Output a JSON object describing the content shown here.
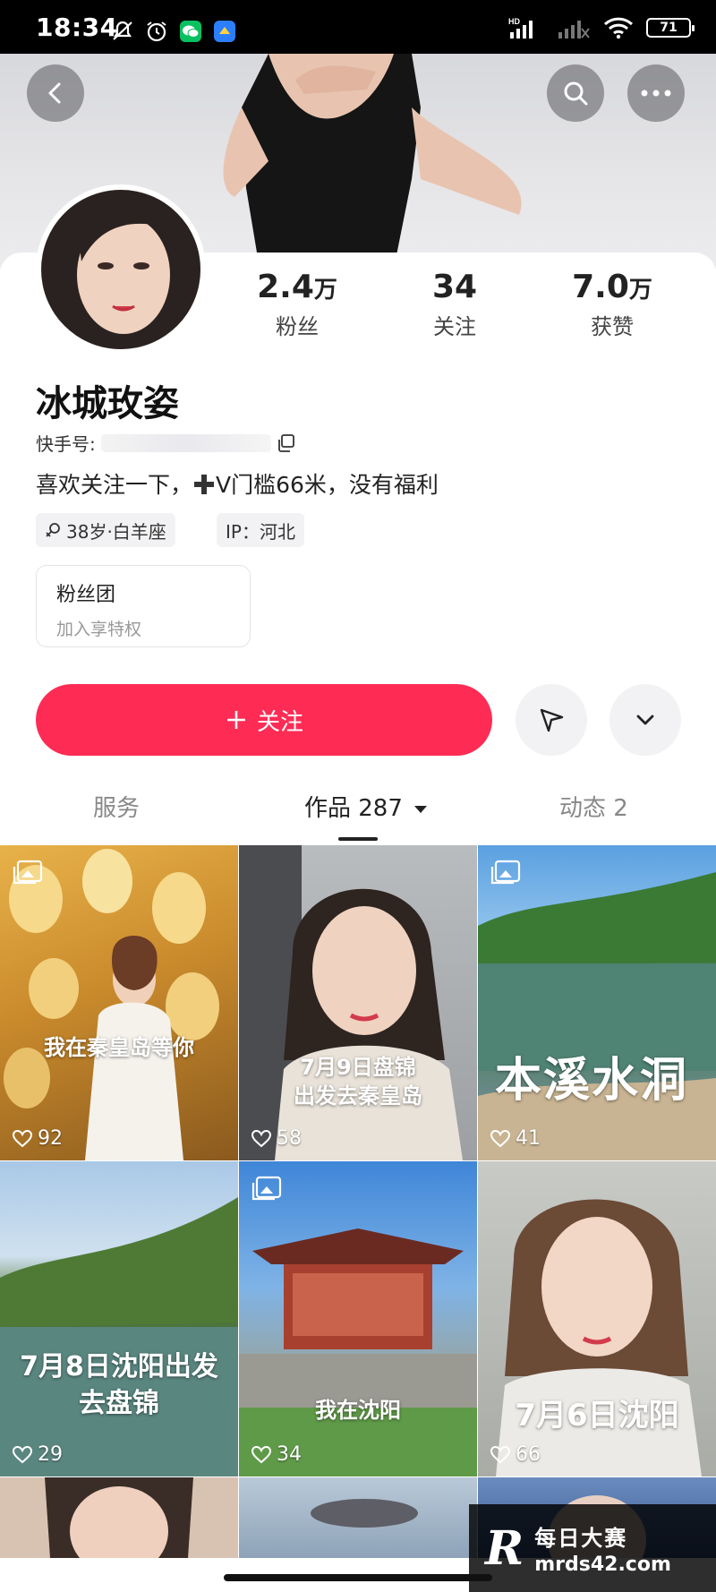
{
  "status_bar": {
    "time": "18:34",
    "network_label": "HD",
    "battery": "71"
  },
  "header": {
    "back_icon": "chevron-left-icon",
    "search_icon": "search-icon",
    "more_icon": "more-horizontal-icon"
  },
  "profile": {
    "name": "冰城玫姿",
    "kuaishou_id_label": "快手号:",
    "bio_prefix": "喜欢关注一下，",
    "bio_suffix": "V门槛66米，没有福利",
    "tags": [
      "38岁·白羊座",
      "IP：河北"
    ],
    "stats": [
      {
        "value": "2.4",
        "unit": "万",
        "label": "粉丝"
      },
      {
        "value": "34",
        "unit": "",
        "label": "关注"
      },
      {
        "value": "7.0",
        "unit": "万",
        "label": "获赞"
      }
    ],
    "fan_group": {
      "title": "粉丝团",
      "subtitle": "加入享特权"
    },
    "follow_label": "关注"
  },
  "tabs": [
    {
      "label": "服务",
      "active": false
    },
    {
      "label": "作品 287",
      "active": true
    },
    {
      "label": "动态 2",
      "active": false
    }
  ],
  "posts": [
    {
      "caption": "我在秦皇岛等你",
      "likes": "92",
      "multi_image": true
    },
    {
      "caption": "7月9日盘锦\n出发去秦皇岛",
      "likes": "58",
      "multi_image": false
    },
    {
      "caption": "本溪水洞",
      "likes": "41",
      "multi_image": true
    },
    {
      "caption": "7月8日沈阳出发\n去盘锦",
      "likes": "29",
      "multi_image": false
    },
    {
      "caption": "我在沈阳",
      "likes": "34",
      "multi_image": true
    },
    {
      "caption": "7月6日沈阳",
      "likes": "66",
      "multi_image": false
    }
  ],
  "watermark": {
    "logo": "R",
    "title": "每日大赛",
    "url": "mrds42.com"
  }
}
